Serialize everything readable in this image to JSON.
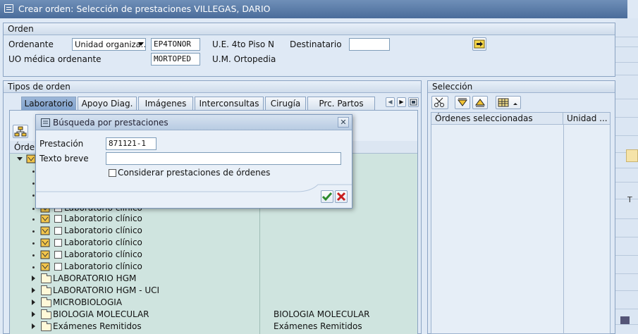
{
  "window": {
    "title": "Crear orden: Selección de prestaciones VILLEGAS, DARIO"
  },
  "orden": {
    "header": "Orden",
    "ordenante_label": "Ordenante",
    "ordenante_value": "Unidad organiza...",
    "ordenante_code": "EP4TONOR",
    "ordenante_desc": "U.E. 4to Piso N",
    "destinatario_label": "Destinatario",
    "destinatario_value": "",
    "uo_label": "UO médica ordenante",
    "uo_code": "MORTOPED",
    "uo_desc": "U.M. Ortopedia"
  },
  "tipos": {
    "header": "Tipos de orden",
    "tabs": [
      "Laboratorio",
      "Apoyo Diag.",
      "Imágenes",
      "Interconsultas",
      "Cirugía",
      "Prc. Partos"
    ],
    "active_tab": "Laboratorio",
    "tree_col_partial": "Órde",
    "tree_rows": [
      {
        "type": "item",
        "label": "Laboratorio clínico",
        "right": ""
      },
      {
        "type": "item",
        "label": "Laboratorio clínico",
        "right": ""
      },
      {
        "type": "item",
        "label": "Laboratorio clínico",
        "right": ""
      },
      {
        "type": "item",
        "label": "Laboratorio clínico",
        "right": ""
      },
      {
        "type": "item",
        "label": "Laboratorio clínico",
        "right": ""
      },
      {
        "type": "item",
        "label": "Laboratorio clínico",
        "right": ""
      },
      {
        "type": "folder",
        "label": "LABORATORIO HGM",
        "right": ""
      },
      {
        "type": "folder",
        "label": "LABORATORIO HGM - UCI",
        "right": ""
      },
      {
        "type": "folder",
        "label": "MICROBIOLOGIA",
        "right": ""
      },
      {
        "type": "folder",
        "label": "BIOLOGIA MOLECULAR",
        "right": "BIOLOGIA MOLECULAR"
      },
      {
        "type": "folder",
        "label": "Exámenes Remitidos",
        "right": "Exámenes Remitidos"
      }
    ]
  },
  "seleccion": {
    "header": "Selección",
    "col1": "Órdenes seleccionadas",
    "col2": "Unidad ..."
  },
  "dialog": {
    "title": "Búsqueda por prestaciones",
    "prestacion_label": "Prestación",
    "prestacion_value": "871121-1",
    "texto_label": "Texto breve",
    "texto_value": "",
    "checkbox_label": "Considerar prestaciones de órdenes"
  },
  "colors": {
    "titlebar": "#4a6c9a",
    "tree_bg": "#cfe4df",
    "accept": "#2e8b2e",
    "cancel": "#c81e1e"
  },
  "right_strip": {
    "text": "T"
  }
}
